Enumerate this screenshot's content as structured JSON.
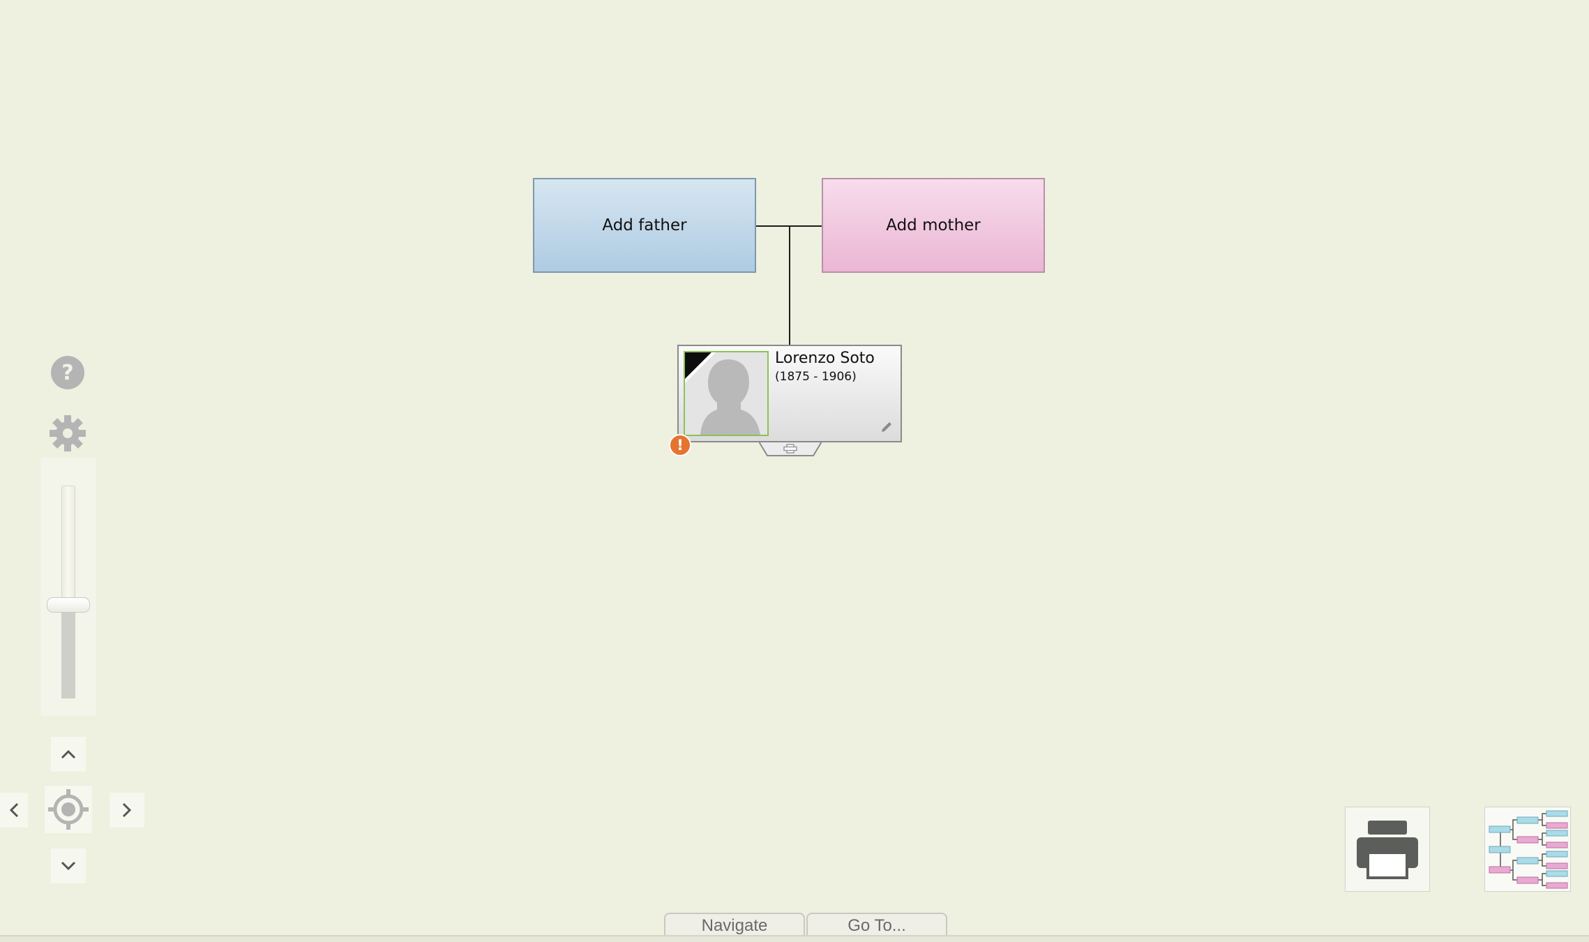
{
  "parents": {
    "father_label": "Add father",
    "mother_label": "Add mother"
  },
  "person": {
    "name": "Lorenzo Soto",
    "dates": "(1875 - 1906)",
    "warning_symbol": "!"
  },
  "bottom_tabs": {
    "navigate_label": "Navigate",
    "goto_label": "Go To..."
  },
  "colors": {
    "background": "#eef0e0",
    "father_box": "#aecbe2",
    "mother_box": "#ebb6d4",
    "portrait_border": "#8cc257",
    "warning": "#e5742f"
  },
  "icons": {
    "help": "help-icon",
    "settings": "gear-icon",
    "pan_up": "chevron-up-icon",
    "pan_down": "chevron-down-icon",
    "pan_left": "chevron-left-icon",
    "pan_right": "chevron-right-icon",
    "center": "crosshair-icon",
    "print": "printer-icon",
    "tree_view": "family-tree-icon",
    "edit": "pencil-icon",
    "add_child": "plus-icon"
  }
}
